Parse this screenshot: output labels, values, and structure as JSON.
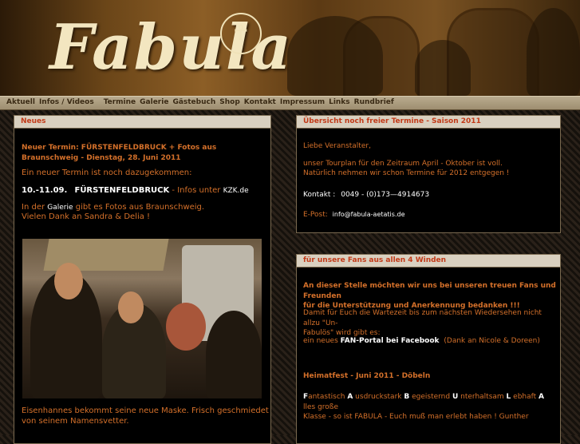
{
  "header": {
    "logo": "Fabula"
  },
  "nav": [
    "Aktuell",
    "Infos / Videos",
    "Termine",
    "Galerie",
    "Gästebuch",
    "Shop",
    "Kontakt",
    "Impressum",
    "Links",
    "Rundbrief"
  ],
  "left_panel": {
    "title": "Neues",
    "headline": "Neuer Termin: FÜRSTENFELDBRUCK + Fotos aus Braunschweig - Dienstag, 28. Juni 2011",
    "intro": "Ein neuer Termin ist noch dazugekommen:",
    "event_date": "10.-11.09.",
    "event_city": "FÜRSTENFELDBRUCK",
    "event_info": "- Infos unter",
    "event_link": "KZK.de",
    "gallery_pre": "In der",
    "gallery_link": "Galerie",
    "gallery_post": "gibt es Fotos aus Braunschweig.",
    "thanks": "Vielen Dank an Sandra & Delia !",
    "caption_1": "Eisenhannes bekommt seine neue Maske. Frisch geschmiedet",
    "caption_2": "von seinem Namensvetter."
  },
  "right_panel_1": {
    "title": "Übersicht noch freier Termine - Saison 2011",
    "greeting": "Liebe Veranstalter,",
    "line1": "unser Tourplan für den Zeitraum April - Oktober ist voll.",
    "line2": "Natürlich nehmen wir schon Termine für 2012 entgegen !",
    "contact_label": "Kontakt :",
    "contact_phone": "0049 - (0)173—4914673",
    "email_label": "E-Post:",
    "email": "info@fabula-aetatis.de"
  },
  "right_panel_2": {
    "title": "für unsere Fans aus allen 4 Winden",
    "thanks_1": "An dieser Stelle möchten wir uns bei unseren treuen Fans und Freunden",
    "thanks_2": "für die Unterstützung und Anerkennung bedanken !!!",
    "wait_1": "Damit für Euch die Wartezeit bis zum nächsten Wiedersehen nicht allzu \"Un-",
    "wait_2": "Fabulös\" wird gibt es:",
    "fan_pre": "ein neues",
    "fan_link": "FAN-Portal bei Facebook",
    "fan_post": "(Dank an Nicole & Doreen)",
    "heimatfest": "Heimatfest - Juni 2011 - Döbeln",
    "acro_1": [
      "F",
      "antastisch ",
      "A",
      " usdruckstark ",
      "B",
      " egeisternd ",
      "U",
      " nterhaltsam ",
      "L",
      " ebhaft ",
      "A",
      " lles große"
    ],
    "acro_2": "Klasse - so ist FABULA - Euch muß man erlebt haben !  Gunther"
  }
}
